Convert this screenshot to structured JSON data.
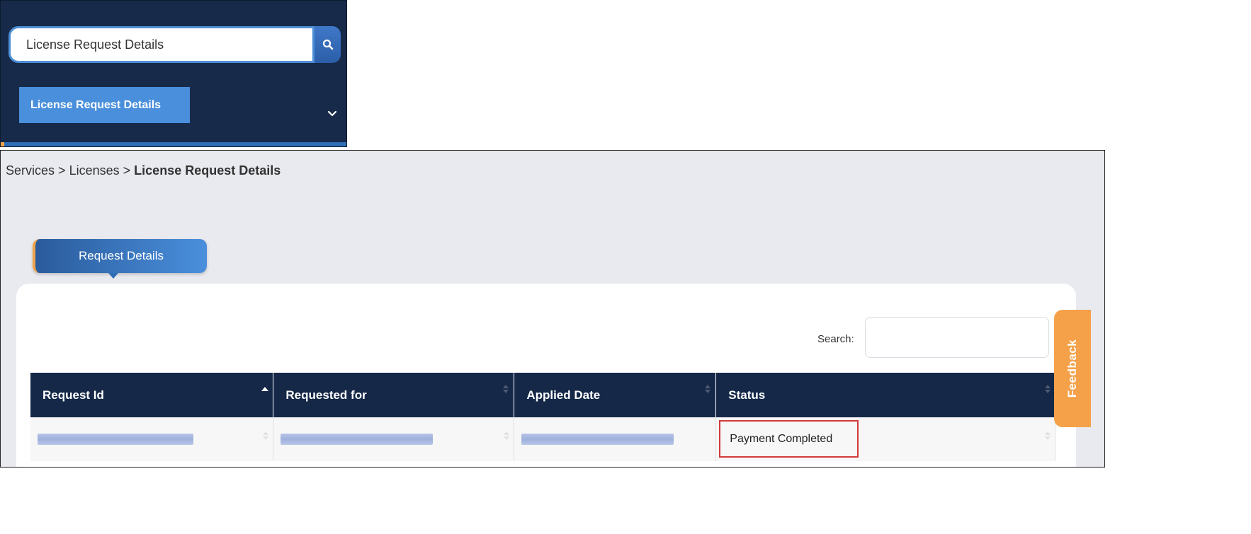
{
  "nav": {
    "search_value": "License Request Details",
    "search_icon": "search-icon",
    "result_label": "License Request Details",
    "chevron_icon": "chevron-down-icon"
  },
  "breadcrumb": {
    "items": [
      "Services",
      "Licenses"
    ],
    "separator": ">",
    "current": "License Request Details"
  },
  "tabs": [
    {
      "label": "Request Details",
      "active": true
    }
  ],
  "table": {
    "search_label": "Search:",
    "search_value": "",
    "columns": [
      "Request Id",
      "Requested for",
      "Applied Date",
      "Status"
    ],
    "rows": [
      {
        "request_id": "",
        "requested_for": "",
        "applied_date": "",
        "status": "Payment Completed"
      }
    ]
  },
  "feedback": {
    "label": "Feedback"
  },
  "colors": {
    "nav_bg": "#172a4a",
    "accent": "#4a8fdc",
    "table_header": "#152848",
    "feedback": "#f4a14a",
    "highlight": "#d23a3a"
  }
}
